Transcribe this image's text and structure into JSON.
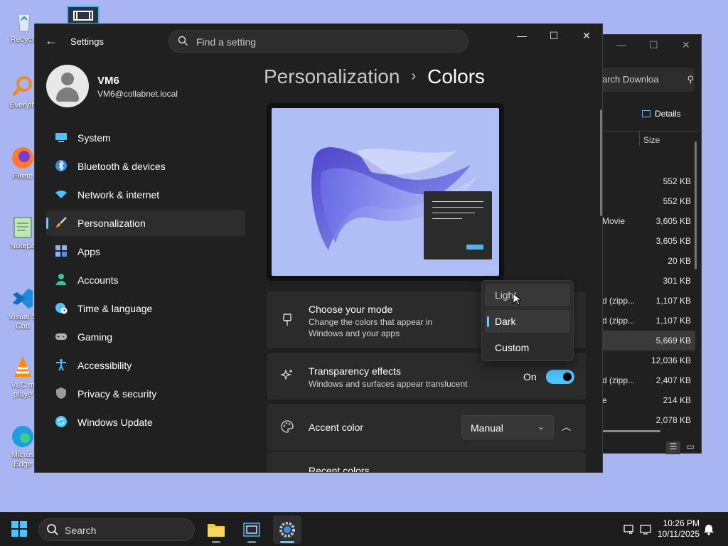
{
  "desktop": {
    "icons": [
      {
        "label": "Recycle",
        "icon": "recycle-bin-icon"
      },
      {
        "label": "Everyth",
        "icon": "everything-search-icon"
      },
      {
        "label": "Firefo",
        "icon": "firefox-icon"
      },
      {
        "label": "Notepa",
        "icon": "notepad-icon"
      },
      {
        "label": "Visual S Cod",
        "icon": "vscode-icon"
      },
      {
        "label": "VLC m playe",
        "icon": "vlc-icon"
      },
      {
        "label": "Micros Edge",
        "icon": "edge-icon"
      }
    ]
  },
  "explorer": {
    "search_text": "arch Downloa",
    "details_label": "Details",
    "size_header": "Size",
    "rows": [
      {
        "name": "",
        "size": "552 KB"
      },
      {
        "name": "",
        "size": "552 KB"
      },
      {
        "name": "Movie",
        "size": "3,605 KB"
      },
      {
        "name": "",
        "size": "3,605 KB"
      },
      {
        "name": "",
        "size": "20 KB"
      },
      {
        "name": "",
        "size": "301 KB"
      },
      {
        "name": "d (zipp...",
        "size": "1,107 KB"
      },
      {
        "name": "d (zipp...",
        "size": "1,107 KB"
      },
      {
        "name": "",
        "size": "5,669 KB"
      },
      {
        "name": "",
        "size": "12,036 KB"
      },
      {
        "name": "d (zipp...",
        "size": "2,407 KB"
      },
      {
        "name": "e",
        "size": "214 KB"
      },
      {
        "name": "",
        "size": "2,078 KB"
      }
    ]
  },
  "settings": {
    "app_title": "Settings",
    "search_placeholder": "Find a setting",
    "user": {
      "name": "VM6",
      "email": "VM6@collabnet.local"
    },
    "nav": [
      {
        "label": "System",
        "icon": "system-icon",
        "color": "#4cc2ff"
      },
      {
        "label": "Bluetooth & devices",
        "icon": "bluetooth-icon",
        "color": "#3a8ee6"
      },
      {
        "label": "Network & internet",
        "icon": "wifi-icon",
        "color": "#4cc2ff"
      },
      {
        "label": "Personalization",
        "icon": "paintbrush-icon",
        "color": "#f0a030",
        "active": true
      },
      {
        "label": "Apps",
        "icon": "apps-icon",
        "color": "#8ab4f8"
      },
      {
        "label": "Accounts",
        "icon": "accounts-icon",
        "color": "#3fc1a0"
      },
      {
        "label": "Time & language",
        "icon": "globe-clock-icon",
        "color": "#4cc2ff"
      },
      {
        "label": "Gaming",
        "icon": "gamepad-icon",
        "color": "#b0b0b0"
      },
      {
        "label": "Accessibility",
        "icon": "accessibility-icon",
        "color": "#4cc2ff"
      },
      {
        "label": "Privacy & security",
        "icon": "shield-icon",
        "color": "#9a9a9a"
      },
      {
        "label": "Windows Update",
        "icon": "windows-update-icon",
        "color": "#4cc2ff"
      }
    ],
    "breadcrumb": {
      "parent": "Personalization",
      "separator": "›",
      "current": "Colors"
    },
    "mode_card": {
      "title": "Choose your mode",
      "description": "Change the colors that appear in Windows and your apps"
    },
    "transparency_card": {
      "title": "Transparency effects",
      "description": "Windows and surfaces appear translucent",
      "toggle_label": "On",
      "toggle_on": true
    },
    "accent_card": {
      "title": "Accent color",
      "select_value": "Manual"
    },
    "recent_colors_label": "Recent colors",
    "mode_dropdown": {
      "options": [
        "Light",
        "Dark",
        "Custom"
      ],
      "selected": "Dark",
      "hovered": "Light"
    },
    "accent_color": "#60cdff"
  },
  "taskbar": {
    "search_label": "Search",
    "time": "10:26 PM",
    "date": "10/11/2025"
  }
}
